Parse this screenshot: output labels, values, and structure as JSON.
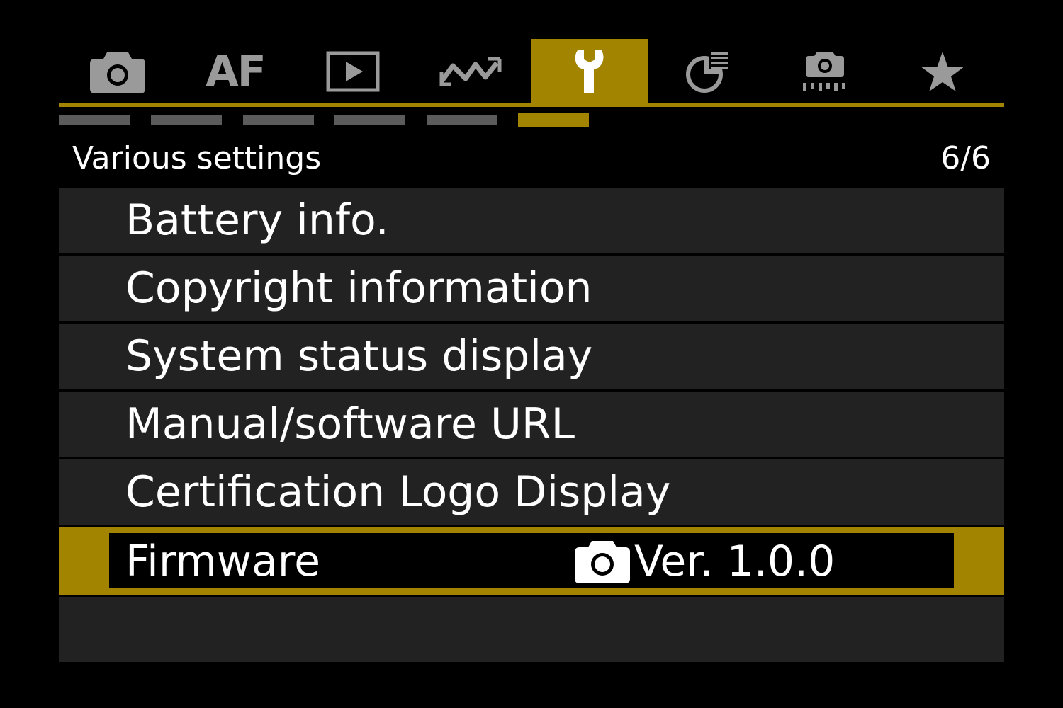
{
  "colors": {
    "accent": "#a38400",
    "background": "#000000",
    "row": "#222222",
    "inactive_icon": "#9a9a9a",
    "inactive_page": "#5b5b5b",
    "text": "#ffffff"
  },
  "tabs": [
    {
      "icon": "camera-icon",
      "label": "",
      "active": false
    },
    {
      "icon": "af-icon",
      "label": "AF",
      "active": false
    },
    {
      "icon": "playback-icon",
      "label": "",
      "active": false
    },
    {
      "icon": "wireless-icon",
      "label": "",
      "active": false
    },
    {
      "icon": "wrench-icon",
      "label": "",
      "active": true
    },
    {
      "icon": "custom-functions-icon",
      "label": "",
      "active": false
    },
    {
      "icon": "custom-shooting-mode-icon",
      "label": "",
      "active": false
    },
    {
      "icon": "my-menu-star-icon",
      "label": "",
      "active": false
    }
  ],
  "pages": {
    "count": 6,
    "current": 6
  },
  "header": {
    "title": "Various settings",
    "page_indicator": "6/6"
  },
  "menu": {
    "items": [
      {
        "label": "Battery info."
      },
      {
        "label": "Copyright information"
      },
      {
        "label": "System status display"
      },
      {
        "label": "Manual/software URL"
      },
      {
        "label": "Certification Logo Display"
      }
    ],
    "selected": {
      "label": "Firmware",
      "value_icon": "camera-icon",
      "value": "Ver. 1.0.0"
    }
  }
}
